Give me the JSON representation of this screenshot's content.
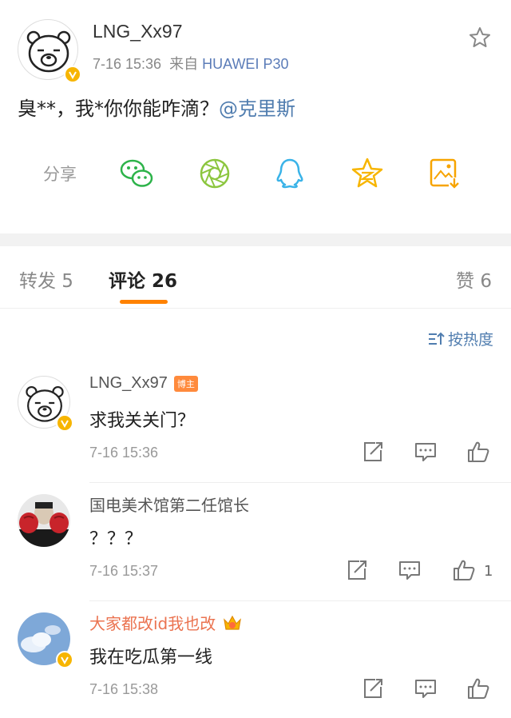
{
  "post": {
    "username": "LNG_Xx97",
    "time": "7-16 15:36",
    "source_prefix": "来自",
    "source": "HUAWEI P30",
    "text": "臭**，我*你你能咋滴？",
    "mention": "@克里斯",
    "share_label": "分享",
    "share_icons": [
      "wechat-icon",
      "moments-icon",
      "qq-icon",
      "qzone-icon",
      "save-image-icon"
    ]
  },
  "tabs": {
    "repost": "转发 5",
    "comment": "评论 26",
    "like": "赞 6"
  },
  "sort_label": "按热度",
  "colors": {
    "accent": "#ff8200",
    "link": "#507daf",
    "badge": "#f7b500"
  },
  "comments": [
    {
      "name": "LNG_Xx97",
      "tag": "博主",
      "text": "求我关关门？",
      "time": "7-16 15:36",
      "likes": ""
    },
    {
      "name": "国电美术馆第二任馆长",
      "text": "？？？",
      "time": "7-16 15:37",
      "likes": "1"
    },
    {
      "name": "大家都改id我也改",
      "text": "我在吃瓜第一线",
      "time": "7-16 15:38",
      "likes": ""
    }
  ]
}
